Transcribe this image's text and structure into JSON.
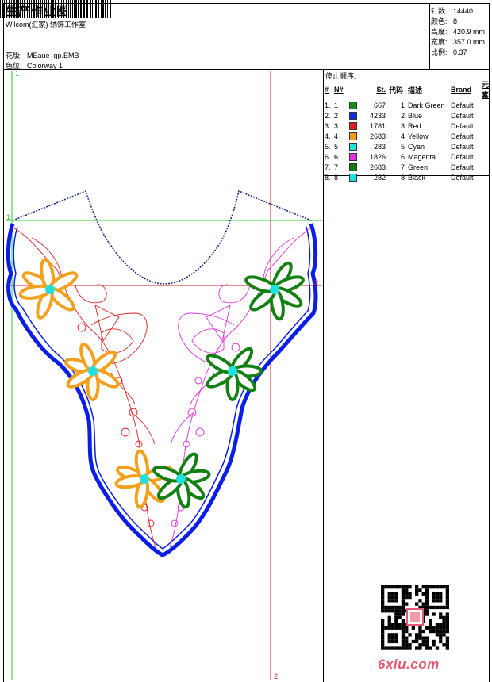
{
  "header": {
    "title": "生产作业图",
    "company": "Wilcom(汇家) 绣饰工作室",
    "design_label": "花版:",
    "design_value": "MEaue_gp.EMB",
    "colorway_label": "色位:",
    "colorway_value": "Colorway 1"
  },
  "stats": [
    {
      "label": "针数:",
      "value": "14440"
    },
    {
      "label": "颜色:",
      "value": "8"
    },
    {
      "label": "高度:",
      "value": "420.9 mm"
    },
    {
      "label": "宽度:",
      "value": "357.0 mm"
    },
    {
      "label": "比例:",
      "value": "0.37"
    }
  ],
  "stop_sequence": {
    "label": "停止顺序:",
    "headers": [
      "#",
      "N#",
      "St.",
      "代码",
      "描述",
      "Brand",
      "元素"
    ],
    "rows": [
      {
        "no": "1.",
        "n": "1",
        "color": "#1a8a1a",
        "st": "667",
        "code": "1",
        "desc": "Dark Green",
        "brand": "Default"
      },
      {
        "no": "2.",
        "n": "2",
        "color": "#1030e0",
        "st": "4233",
        "code": "2",
        "desc": "Blue",
        "brand": "Default"
      },
      {
        "no": "3.",
        "n": "3",
        "color": "#e02020",
        "st": "1781",
        "code": "3",
        "desc": "Red",
        "brand": "Default"
      },
      {
        "no": "4.",
        "n": "4",
        "color": "#f39a1c",
        "st": "2683",
        "code": "4",
        "desc": "Yellow",
        "brand": "Default"
      },
      {
        "no": "5.",
        "n": "5",
        "color": "#20e0e0",
        "st": "283",
        "code": "5",
        "desc": "Cyan",
        "brand": "Default"
      },
      {
        "no": "6.",
        "n": "6",
        "color": "#e030e0",
        "st": "1826",
        "code": "6",
        "desc": "Magenta",
        "brand": "Default"
      },
      {
        "no": "7.",
        "n": "7",
        "color": "#127a12",
        "st": "2683",
        "code": "7",
        "desc": "Green",
        "brand": "Default"
      },
      {
        "no": "8.",
        "n": "8",
        "color": "#20e0e0",
        "st": "282",
        "code": "8",
        "desc": "Black",
        "brand": "Default"
      }
    ]
  },
  "guides": {
    "v1": "1",
    "v2": "2",
    "h1": "1",
    "h2": "2"
  },
  "watermark": {
    "site": "6xiu.com"
  },
  "colors": {
    "guide_green": "#22cc22",
    "guide_red": "#cc2222",
    "outline_blue": "#0a1ee6",
    "neck_navy": "#1a2a8a",
    "flower_orange": "#f5a01c",
    "flower_green": "#128012",
    "center_cyan": "#20e0e0",
    "vine_red": "#e02020",
    "vine_magenta": "#e030e0"
  },
  "icons": {
    "barcode": "barcode-icon",
    "qr": "qr-code-icon"
  }
}
